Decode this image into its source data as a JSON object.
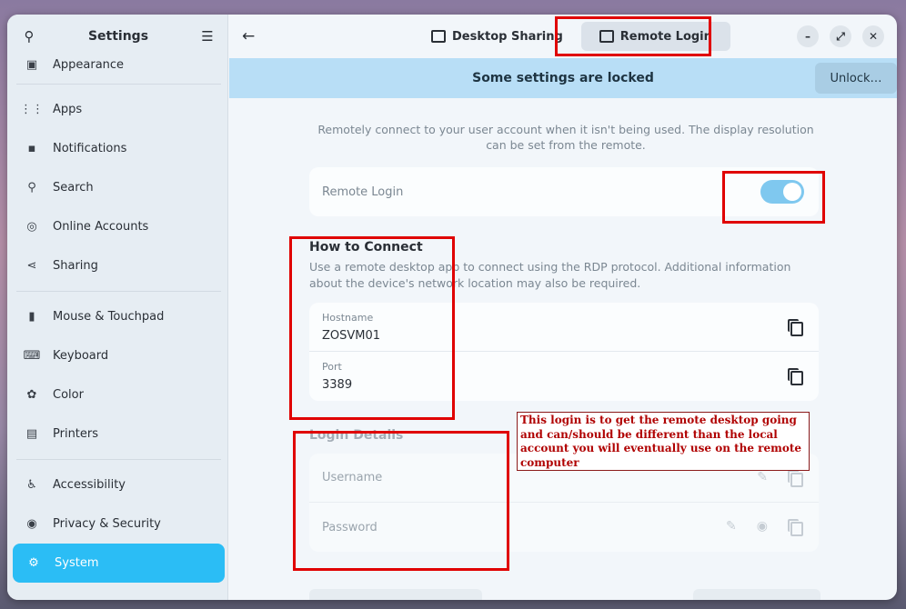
{
  "sidebar": {
    "title": "Settings",
    "items": [
      {
        "label": "Appearance",
        "icon": "appearance-icon",
        "glyph": "▣"
      },
      {
        "label": "Apps",
        "icon": "apps-icon",
        "glyph": "⋮⋮"
      },
      {
        "label": "Notifications",
        "icon": "notifications-icon",
        "glyph": "▪"
      },
      {
        "label": "Search",
        "icon": "search-icon",
        "glyph": "⚲"
      },
      {
        "label": "Online Accounts",
        "icon": "online-accounts-icon",
        "glyph": "◎"
      },
      {
        "label": "Sharing",
        "icon": "sharing-icon",
        "glyph": "⋖"
      },
      {
        "label": "Mouse & Touchpad",
        "icon": "mouse-icon",
        "glyph": "▮"
      },
      {
        "label": "Keyboard",
        "icon": "keyboard-icon",
        "glyph": "⌨"
      },
      {
        "label": "Color",
        "icon": "color-icon",
        "glyph": "✿"
      },
      {
        "label": "Printers",
        "icon": "printer-icon",
        "glyph": "▤"
      },
      {
        "label": "Accessibility",
        "icon": "accessibility-icon",
        "glyph": "♿"
      },
      {
        "label": "Privacy & Security",
        "icon": "privacy-icon",
        "glyph": "◉"
      },
      {
        "label": "System",
        "icon": "system-icon",
        "glyph": "⚙",
        "active": true
      }
    ]
  },
  "tabs": [
    {
      "label": "Desktop Sharing",
      "active": false
    },
    {
      "label": "Remote Login",
      "active": true
    }
  ],
  "lockbar": {
    "text": "Some settings are locked",
    "button": "Unlock…"
  },
  "description": "Remotely connect to your user account when it isn't being used. The display resolution can be set from the remote.",
  "remote_login": {
    "label": "Remote Login",
    "enabled": true
  },
  "how_to_connect": {
    "title": "How to Connect",
    "desc": "Use a remote desktop app to connect using the RDP protocol. Additional information about the device's network location may also be required.",
    "hostname_label": "Hostname",
    "hostname": "ZOSVM01",
    "port_label": "Port",
    "port": "3389"
  },
  "login_details": {
    "title": "Login Details",
    "username_label": "Username",
    "password_label": "Password"
  },
  "annotation": "This login is to get the remote desktop going and can/should be different than the local account you will eventually use on the remote computer",
  "colors": {
    "accent": "#2bbdf5",
    "annotation": "#e00000"
  }
}
